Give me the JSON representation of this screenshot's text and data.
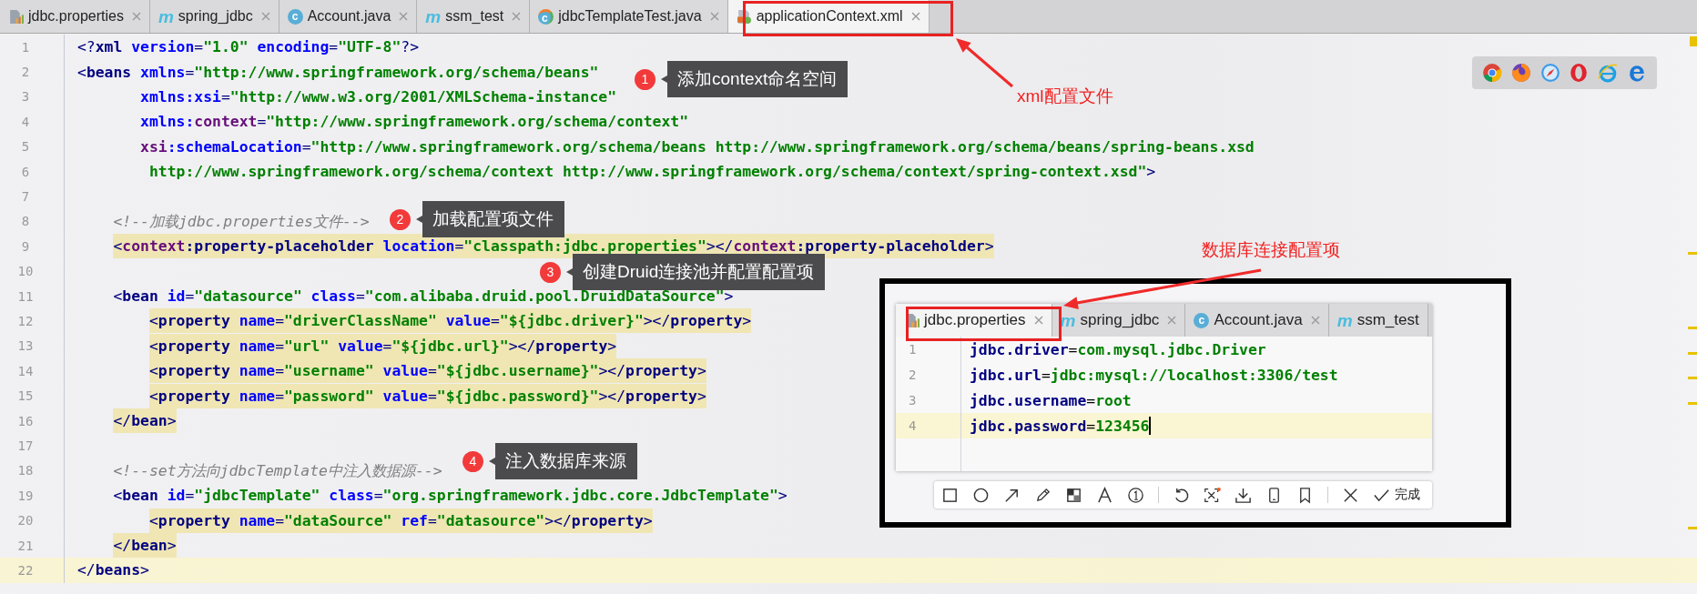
{
  "tabs": [
    {
      "label": "jdbc.properties",
      "kind": "properties",
      "selected": false
    },
    {
      "label": "spring_jdbc",
      "kind": "module",
      "glyph": "m",
      "selected": false
    },
    {
      "label": "Account.java",
      "kind": "class",
      "glyph": "c",
      "selected": false
    },
    {
      "label": "ssm_test",
      "kind": "module",
      "glyph": "m",
      "selected": false
    },
    {
      "label": "jdbcTemplateTest.java",
      "kind": "test",
      "glyph": "c",
      "selected": false
    },
    {
      "label": "applicationContext.xml",
      "kind": "xml",
      "selected": true
    }
  ],
  "editor": {
    "lines": [
      {
        "number": "1",
        "highlighted": false,
        "current": false,
        "tokens": [
          {
            "kind": "punct",
            "text": "<?"
          },
          {
            "kind": "tag",
            "text": "xml"
          },
          {
            "kind": "attr",
            "text": " version"
          },
          {
            "kind": "punct",
            "text": "="
          },
          {
            "kind": "value",
            "text": "\"1.0\""
          },
          {
            "kind": "attr",
            "text": " encoding"
          },
          {
            "kind": "punct",
            "text": "="
          },
          {
            "kind": "value",
            "text": "\"UTF-8\""
          },
          {
            "kind": "punct",
            "text": "?>"
          }
        ]
      },
      {
        "number": "2",
        "highlighted": false,
        "current": false,
        "tokens": [
          {
            "kind": "punct",
            "text": "<"
          },
          {
            "kind": "tag",
            "text": "beans"
          },
          {
            "kind": "attr",
            "text": " xmlns"
          },
          {
            "kind": "punct",
            "text": "="
          },
          {
            "kind": "value",
            "text": "\"http://www.springframework.org/schema/beans\""
          }
        ]
      },
      {
        "number": "3",
        "highlighted": false,
        "current": false,
        "tokens": [
          {
            "kind": "attr",
            "text": "       xmlns:xsi"
          },
          {
            "kind": "punct",
            "text": "="
          },
          {
            "kind": "value",
            "text": "\"http://www.w3.org/2001/XMLSchema-instance\""
          }
        ]
      },
      {
        "number": "4",
        "highlighted": false,
        "current": false,
        "tokens": [
          {
            "kind": "attr",
            "text": "       xmlns:"
          },
          {
            "kind": "ns",
            "text": "context"
          },
          {
            "kind": "punct",
            "text": "="
          },
          {
            "kind": "value",
            "text": "\"http://www.springframework.org/schema/context\""
          }
        ]
      },
      {
        "number": "5",
        "highlighted": false,
        "current": false,
        "tokens": [
          {
            "kind": "ns",
            "text": "       xsi"
          },
          {
            "kind": "attr",
            "text": ":schemaLocation"
          },
          {
            "kind": "punct",
            "text": "="
          },
          {
            "kind": "value",
            "text": "\"http://www.springframework.org/schema/beans http://www.springframework.org/schema/beans/spring-beans.xsd"
          }
        ]
      },
      {
        "number": "6",
        "highlighted": false,
        "current": false,
        "tokens": [
          {
            "kind": "value",
            "text": "        http://www.springframework.org/schema/context http://www.springframework.org/schema/context/spring-context.xsd\""
          },
          {
            "kind": "punct",
            "text": ">"
          }
        ]
      },
      {
        "number": "7",
        "current": false
      },
      {
        "number": "8",
        "highlighted": false,
        "current": false,
        "tokens": [
          {
            "kind": "comment",
            "text": "    <!--加载jdbc.properties文件-->"
          }
        ]
      },
      {
        "number": "9",
        "highlighted": true,
        "current": false,
        "tokens": [
          {
            "kind": "punct",
            "text": "    <"
          },
          {
            "kind": "ns",
            "text": "context"
          },
          {
            "kind": "tag",
            "text": ":property-placeholder"
          },
          {
            "kind": "attr",
            "text": " location"
          },
          {
            "kind": "punct",
            "text": "="
          },
          {
            "kind": "value",
            "text": "\"classpath:jdbc.properties\""
          },
          {
            "kind": "punct",
            "text": "></"
          },
          {
            "kind": "ns",
            "text": "context"
          },
          {
            "kind": "tag",
            "text": ":property-placeholder"
          },
          {
            "kind": "punct",
            "text": ">"
          }
        ]
      },
      {
        "number": "10",
        "current": false
      },
      {
        "number": "11",
        "highlighted": false,
        "current": false,
        "tokens": [
          {
            "kind": "punct",
            "text": "    <"
          },
          {
            "kind": "tag",
            "text": "bean"
          },
          {
            "kind": "attr",
            "text": " id"
          },
          {
            "kind": "punct",
            "text": "="
          },
          {
            "kind": "value",
            "text": "\"datasource\""
          },
          {
            "kind": "attr",
            "text": " class"
          },
          {
            "kind": "punct",
            "text": "="
          },
          {
            "kind": "value",
            "text": "\"com.alibaba.druid.pool.DruidDataSource\""
          },
          {
            "kind": "punct",
            "text": ">"
          }
        ]
      },
      {
        "number": "12",
        "highlighted": true,
        "current": false,
        "tokens": [
          {
            "kind": "punct",
            "text": "        <"
          },
          {
            "kind": "tag",
            "text": "property"
          },
          {
            "kind": "attr",
            "text": " name"
          },
          {
            "kind": "punct",
            "text": "="
          },
          {
            "kind": "value",
            "text": "\"driverClassName\""
          },
          {
            "kind": "attr",
            "text": " value"
          },
          {
            "kind": "punct",
            "text": "="
          },
          {
            "kind": "value",
            "text": "\"${jdbc.driver}\""
          },
          {
            "kind": "punct",
            "text": "></"
          },
          {
            "kind": "tag",
            "text": "property"
          },
          {
            "kind": "punct",
            "text": ">"
          }
        ]
      },
      {
        "number": "13",
        "highlighted": true,
        "current": false,
        "tokens": [
          {
            "kind": "punct",
            "text": "        <"
          },
          {
            "kind": "tag",
            "text": "property"
          },
          {
            "kind": "attr",
            "text": " name"
          },
          {
            "kind": "punct",
            "text": "="
          },
          {
            "kind": "value",
            "text": "\"url\""
          },
          {
            "kind": "attr",
            "text": " value"
          },
          {
            "kind": "punct",
            "text": "="
          },
          {
            "kind": "value",
            "text": "\"${jdbc.url}\""
          },
          {
            "kind": "punct",
            "text": "></"
          },
          {
            "kind": "tag",
            "text": "property"
          },
          {
            "kind": "punct",
            "text": ">"
          }
        ]
      },
      {
        "number": "14",
        "highlighted": true,
        "current": false,
        "tokens": [
          {
            "kind": "punct",
            "text": "        <"
          },
          {
            "kind": "tag",
            "text": "property"
          },
          {
            "kind": "attr",
            "text": " name"
          },
          {
            "kind": "punct",
            "text": "="
          },
          {
            "kind": "value",
            "text": "\"username\""
          },
          {
            "kind": "attr",
            "text": " value"
          },
          {
            "kind": "punct",
            "text": "="
          },
          {
            "kind": "value",
            "text": "\"${jdbc.username}\""
          },
          {
            "kind": "punct",
            "text": "></"
          },
          {
            "kind": "tag",
            "text": "property"
          },
          {
            "kind": "punct",
            "text": ">"
          }
        ]
      },
      {
        "number": "15",
        "highlighted": true,
        "current": false,
        "tokens": [
          {
            "kind": "punct",
            "text": "        <"
          },
          {
            "kind": "tag",
            "text": "property"
          },
          {
            "kind": "attr",
            "text": " name"
          },
          {
            "kind": "punct",
            "text": "="
          },
          {
            "kind": "value",
            "text": "\"password\""
          },
          {
            "kind": "attr",
            "text": " value"
          },
          {
            "kind": "punct",
            "text": "="
          },
          {
            "kind": "value",
            "text": "\"${jdbc.password}\""
          },
          {
            "kind": "punct",
            "text": "></"
          },
          {
            "kind": "tag",
            "text": "property"
          },
          {
            "kind": "punct",
            "text": ">"
          }
        ]
      },
      {
        "number": "16",
        "highlighted": true,
        "current": false,
        "tokens": [
          {
            "kind": "punct",
            "text": "    </"
          },
          {
            "kind": "tag",
            "text": "bean"
          },
          {
            "kind": "punct",
            "text": ">"
          }
        ]
      },
      {
        "number": "17",
        "current": false
      },
      {
        "number": "18",
        "highlighted": false,
        "current": false,
        "tokens": [
          {
            "kind": "comment",
            "text": "    <!--set方法向jdbcTemplate中注入数据源-->"
          }
        ]
      },
      {
        "number": "19",
        "highlighted": false,
        "current": false,
        "tokens": [
          {
            "kind": "punct",
            "text": "    <"
          },
          {
            "kind": "tag",
            "text": "bean"
          },
          {
            "kind": "attr",
            "text": " id"
          },
          {
            "kind": "punct",
            "text": "="
          },
          {
            "kind": "value",
            "text": "\"jdbcTemplate\""
          },
          {
            "kind": "attr",
            "text": " class"
          },
          {
            "kind": "punct",
            "text": "="
          },
          {
            "kind": "value",
            "text": "\"org.springframework.jdbc.core.JdbcTemplate\""
          },
          {
            "kind": "punct",
            "text": ">"
          }
        ]
      },
      {
        "number": "20",
        "highlighted": true,
        "current": false,
        "tokens": [
          {
            "kind": "punct",
            "text": "        <"
          },
          {
            "kind": "tag",
            "text": "property"
          },
          {
            "kind": "attr",
            "text": " name"
          },
          {
            "kind": "punct",
            "text": "="
          },
          {
            "kind": "value",
            "text": "\"dataSource\""
          },
          {
            "kind": "attr",
            "text": " ref"
          },
          {
            "kind": "punct",
            "text": "="
          },
          {
            "kind": "value",
            "text": "\"datasource\""
          },
          {
            "kind": "punct",
            "text": "></"
          },
          {
            "kind": "tag",
            "text": "property"
          },
          {
            "kind": "punct",
            "text": ">"
          }
        ]
      },
      {
        "number": "21",
        "highlighted": true,
        "current": false,
        "tokens": [
          {
            "kind": "punct",
            "text": "    </"
          },
          {
            "kind": "tag",
            "text": "bean"
          },
          {
            "kind": "punct",
            "text": ">"
          }
        ]
      },
      {
        "number": "22",
        "highlighted": false,
        "current": true,
        "tokens": [
          {
            "kind": "punct",
            "text": "</"
          },
          {
            "kind": "tag",
            "text": "beans"
          },
          {
            "kind": "punct",
            "text": ">"
          }
        ]
      }
    ]
  },
  "callouts": [
    {
      "number": "1",
      "text": "添加context命名空间"
    },
    {
      "number": "2",
      "text": "加载配置项文件"
    },
    {
      "number": "3",
      "text": "创建Druid连接池并配置配置项"
    },
    {
      "number": "4",
      "text": "注入数据库来源"
    }
  ],
  "annotations": [
    {
      "text": "xml配置文件"
    },
    {
      "text": "数据库连接配置项"
    }
  ],
  "inset": {
    "tabs": [
      {
        "label": "jdbc.properties",
        "kind": "properties",
        "selected": true
      },
      {
        "label": "spring_jdbc",
        "kind": "module",
        "glyph": "m",
        "selected": false
      },
      {
        "label": "Account.java",
        "kind": "class",
        "glyph": "c",
        "selected": false
      },
      {
        "label": "ssm_test",
        "kind": "module",
        "glyph": "m",
        "selected": false
      }
    ],
    "lines": [
      {
        "number": "1",
        "current": false,
        "tokens": [
          {
            "kind": "key",
            "text": "jdbc.driver"
          },
          {
            "kind": "eq",
            "text": "="
          },
          {
            "kind": "value",
            "text": "com.mysql.jdbc.Driver"
          }
        ]
      },
      {
        "number": "2",
        "current": false,
        "tokens": [
          {
            "kind": "key",
            "text": "jdbc.url"
          },
          {
            "kind": "eq",
            "text": "="
          },
          {
            "kind": "value",
            "text": "jdbc:mysql://localhost:3306/test"
          }
        ]
      },
      {
        "number": "3",
        "current": false,
        "tokens": [
          {
            "kind": "key",
            "text": "jdbc.username"
          },
          {
            "kind": "eq",
            "text": "="
          },
          {
            "kind": "value",
            "text": "root"
          }
        ]
      },
      {
        "number": "4",
        "current": true,
        "tokens": [
          {
            "kind": "key",
            "text": "jdbc.password"
          },
          {
            "kind": "eq",
            "text": "="
          },
          {
            "kind": "value",
            "text": "123456"
          }
        ]
      }
    ],
    "done_label": "完成"
  }
}
